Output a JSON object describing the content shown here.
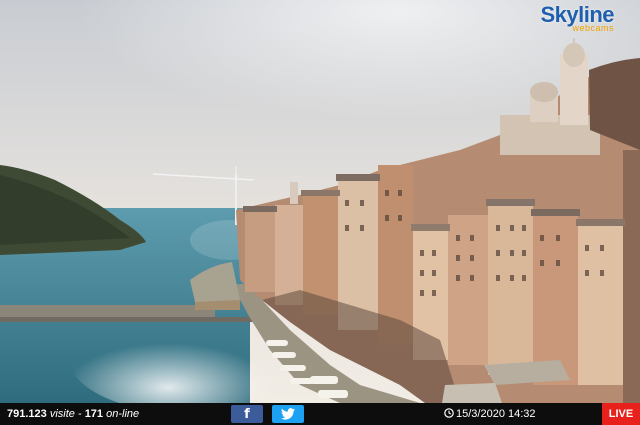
{
  "brand": {
    "name": "Skyline",
    "sub": "webcams"
  },
  "footer": {
    "visits_count": "791.123",
    "visits_label": "visite",
    "separator": "-",
    "online_count": "171",
    "online_label": "on-line",
    "facebook_label": "f",
    "date_time": "15/3/2020 14:32",
    "live_label": "LIVE"
  },
  "icons": {
    "facebook": "facebook-icon",
    "twitter": "twitter-bird-icon",
    "clock": "clock-icon"
  },
  "colors": {
    "facebook": "#3b5b9a",
    "twitter": "#1da1f2",
    "live": "#e8211c",
    "brand_blue": "#1f5fae",
    "brand_orange": "#f0a400"
  }
}
